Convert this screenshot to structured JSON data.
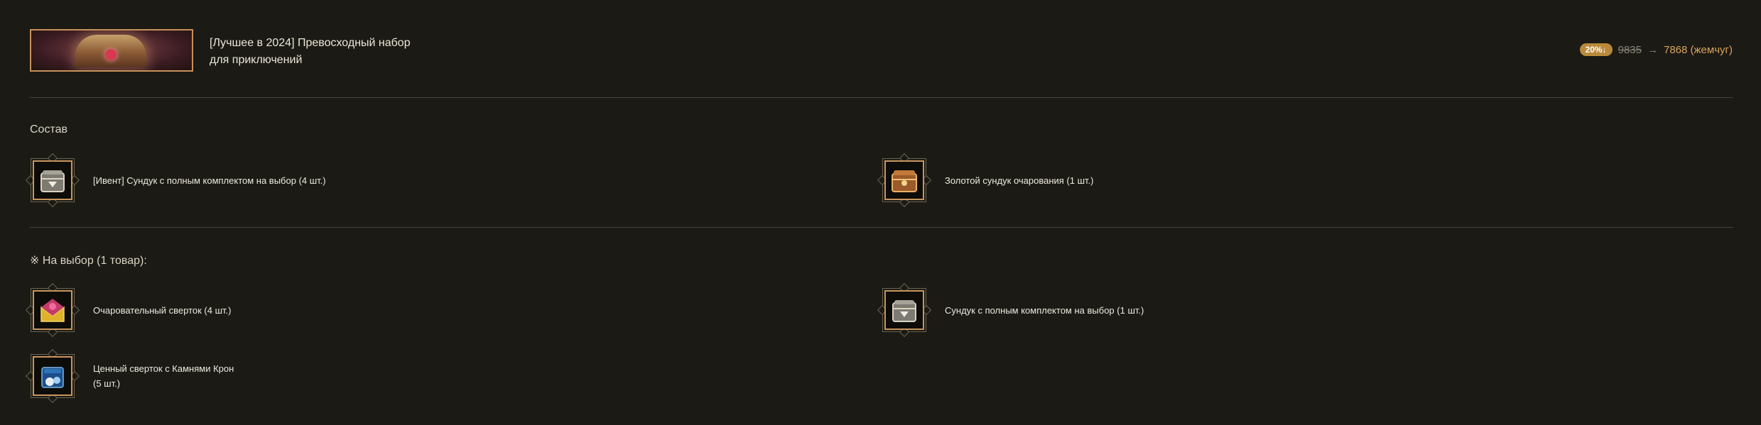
{
  "header": {
    "title_line1": "[Лучшее в 2024] Превосходный набор",
    "title_line2": "для приключений",
    "discount_badge": "20%↓",
    "old_price": "9835",
    "arrow": "→",
    "new_price": "7868 (жемчуг)"
  },
  "composition": {
    "label": "Состав",
    "items": [
      {
        "label": "[Ивент] Сундук с полным комплектом на выбор (4 шт.)",
        "icon": "silver-chest-icon"
      },
      {
        "label": "Золотой сундук очарования (1 шт.)",
        "icon": "golden-chest-icon"
      }
    ]
  },
  "choice": {
    "label": "※ На выбор (1 товар):",
    "items": [
      {
        "label": "Очаровательный сверток (4 шт.)",
        "icon": "charming-bundle-icon"
      },
      {
        "label": "Сундук с полным комплектом на выбор (1 шт.)",
        "icon": "silver-chest-icon"
      },
      {
        "label_line1": "Ценный сверток с Камнями Крон",
        "label_line2": "(5 шт.)",
        "icon": "crown-stone-bundle-icon"
      }
    ]
  },
  "colors": {
    "background": "#1b1a14",
    "accent": "#d9a35c",
    "badge": "#b98a3a",
    "frame": "#c8955d"
  }
}
